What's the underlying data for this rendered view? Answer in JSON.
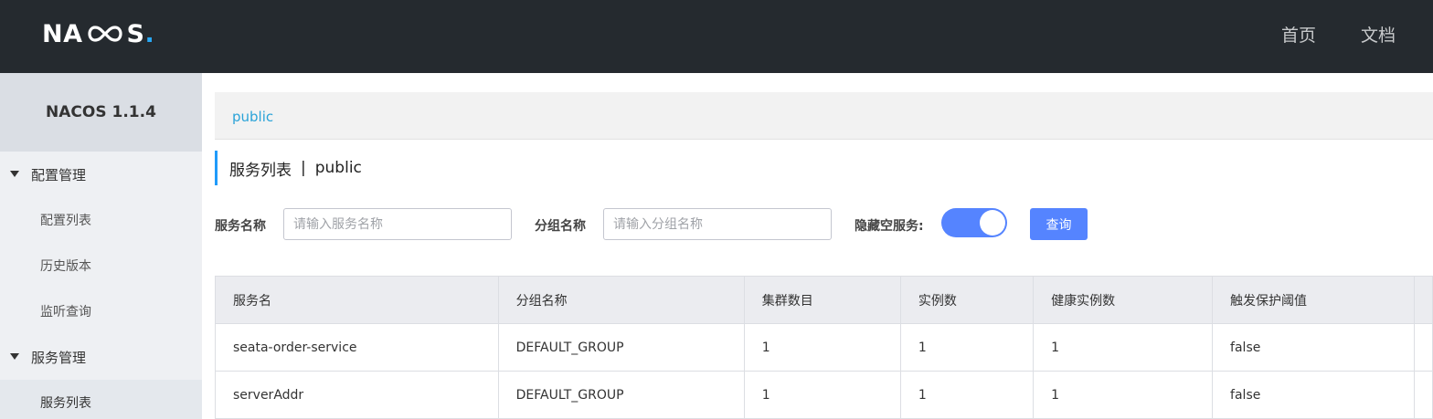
{
  "header": {
    "logo_text": "NACOS",
    "nav": [
      "首页",
      "文档"
    ]
  },
  "sidebar": {
    "version": "NACOS 1.1.4",
    "groups": [
      {
        "label": "配置管理",
        "items": [
          "配置列表",
          "历史版本",
          "监听查询"
        ]
      },
      {
        "label": "服务管理",
        "items": [
          "服务列表"
        ]
      }
    ]
  },
  "main": {
    "namespace": "public",
    "title": "服务列表",
    "title_sep": "|",
    "title_ns": "public",
    "filters": {
      "service_label": "服务名称",
      "service_placeholder": "请输入服务名称",
      "group_label": "分组名称",
      "group_placeholder": "请输入分组名称",
      "hide_empty_label": "隐藏空服务:",
      "hide_empty_on": true,
      "query_label": "查询"
    },
    "table": {
      "headers": [
        "服务名",
        "分组名称",
        "集群数目",
        "实例数",
        "健康实例数",
        "触发保护阈值"
      ],
      "rows": [
        [
          "seata-order-service",
          "DEFAULT_GROUP",
          "1",
          "1",
          "1",
          "false"
        ],
        [
          "serverAddr",
          "DEFAULT_GROUP",
          "1",
          "1",
          "1",
          "false"
        ]
      ]
    }
  },
  "colors": {
    "topbar": "#252a2f",
    "accent": "#5584ff",
    "namespace_link": "#2aa3d8"
  }
}
